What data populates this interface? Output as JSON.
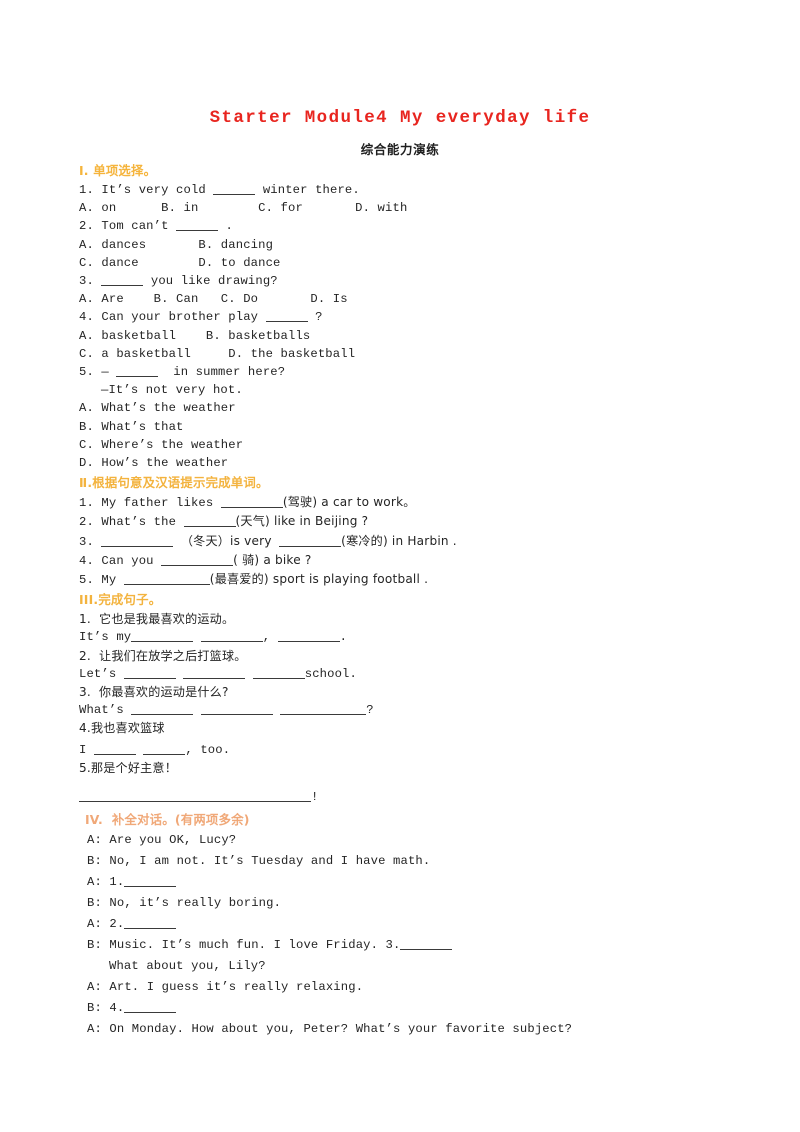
{
  "document": {
    "title": "Starter Module4  My everyday life",
    "subtitle": "综合能力演练",
    "title_color": "#e8251f",
    "heading_color": "#f5b43c",
    "heading_color_alt": "#f0a878"
  },
  "sections": [
    {
      "heading": "Ⅰ. 单项选择。",
      "lines": [
        "1. It’s very cold ____ winter there.",
        "A. on      B. in       C. for        D. with",
        "2. Tom can’t ____ .",
        "A. dances        B. dancing",
        "C. dance         D. to dance",
        "3. ____ you like drawing?",
        "A. Are    B. Can    C. Do       D. Is",
        "4. Can your brother play ____ ?",
        "A. basketball     B. basketballs",
        "C. a basketball     D. the basketball",
        "5. — ____  in summer here?",
        "  —It’s not very hot.",
        "A. What’s the weather",
        "B. What’s that",
        "C. Where’s the weather",
        "D. How’s the weather"
      ]
    },
    {
      "heading": "Ⅱ.根据句意及汉语提示完成单词。",
      "lines": [
        "1. My father likes ______(驾驶) a car to work。",
        "2. What’s the _____(天气) like in Beijing ?",
        "3. _______（冬天）is very ______(寒冷的) in Harbin .",
        "4. Can you _______( 骑) a bike ?",
        "5. My ________(最喜爱的) sport is playing football ."
      ]
    },
    {
      "heading": "III.完成句子。",
      "lines": [
        "1.  它也是我最喜欢的运动。",
        "It’s my_______ ________, ________.",
        "2.  让我们在放学之后打篮球。",
        "Let’s ______ ________ ______school.",
        "3.  你最喜欢的运动是什么?",
        "What’s ________ _________ __________?",
        "4.我也喜欢篮球",
        "I _____ _____, too.",
        "5.那是个好主意！",
        "______________________!"
      ]
    },
    {
      "heading": "IV.  补全对话。(有两项多余)",
      "lines": [
        "A: Are you OK, Lucy?",
        "B: No, I am not. It’s Tuesday and I have math.",
        "A: 1._____",
        "B: No, it’s really boring.",
        "A: 2._____",
        "B: Music. It’s much fun. I love Friday. 3._____",
        "What about you, Lily?",
        "A: Art. I guess it’s really relaxing.",
        "B: 4._____",
        "A: On Monday. How about you, Peter? What’s your favorite subject?"
      ]
    }
  ],
  "s1": {
    "h": "Ⅰ. 单项选择。",
    "q1": "1. It’s very cold",
    "q1b": "winter there.",
    "q1o": "A. on      B. in        C. for       D. with",
    "q2": "2. Tom can’t",
    "q2b": ".",
    "q2o1": "A. dances       B. dancing",
    "q2o2": "C. dance        D. to dance",
    "q3b": "you like drawing?",
    "q3n": "3.",
    "q3o": "A. Are    B. Can   C. Do       D. Is",
    "q4": "4. Can your brother play",
    "q4b": "?",
    "q4o1": "A. basketball    B. basketballs",
    "q4o2": "C. a basketball     D. the basketball",
    "q5": "5. —",
    "q5b": "in summer here?",
    "q5c": "—It’s not very hot.",
    "q5o1": "A. What’s the weather",
    "q5o2": "B. What’s that",
    "q5o3": "C. Where’s the weather",
    "q5o4": "D. How’s the weather"
  },
  "s2": {
    "h": "Ⅱ.根据句意及汉语提示完成单词。",
    "q1a": "1. My father likes",
    "q1b": "(驾驶) a car to work。",
    "q2a": "2. What’s the",
    "q2b": "(天气) like in Beijing ?",
    "q3a": "3.",
    "q3b": "（冬天）is very",
    "q3c": "(寒冷的) in Harbin .",
    "q4a": "4. Can you",
    "q4b": "( 骑) a bike ?",
    "q5a": "5. My",
    "q5b": "(最喜爱的) sport is playing football ."
  },
  "s3": {
    "h": "III.完成句子。",
    "q1": "1.  它也是我最喜欢的运动。",
    "a1a": "It’s my",
    "a1b": ",",
    "a1c": ".",
    "q2": "2.  让我们在放学之后打篮球。",
    "a2a": "Let’s",
    "a2b": "school.",
    "q3": "3.  你最喜欢的运动是什么?",
    "a3a": "What’s",
    "a3b": "?",
    "q4": "4.我也喜欢篮球",
    "a4a": "I",
    "a4b": ", too.",
    "q5": "5.那是个好主意！",
    "a5b": "!"
  },
  "s4": {
    "h": "IV.  补全对话。(有两项多余)",
    "l1": "A: Are you OK, Lucy?",
    "l2": "B: No, I am not. It’s Tuesday and I have math.",
    "l3a": "A: 1.",
    "l4": "B: No, it’s really boring.",
    "l5a": "A: 2.",
    "l6a": "B: Music. It’s much fun. I love Friday. 3.",
    "l7": "What about you, Lily?",
    "l8": "A: Art. I guess it’s really relaxing.",
    "l9a": "B: 4.",
    "l10": "A: On Monday. How about you, Peter? What’s your favorite subject?"
  }
}
